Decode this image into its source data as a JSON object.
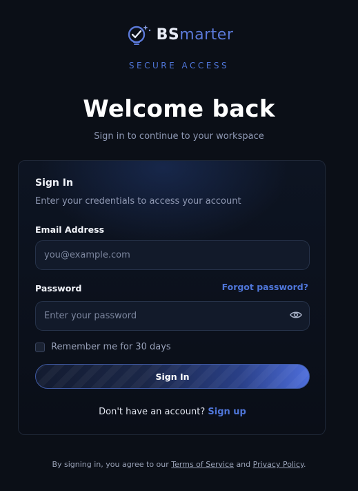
{
  "brand": {
    "name_bold": "BS",
    "name_light": "marter",
    "tagline": "SECURE ACCESS",
    "accent_color": "#4f76d9",
    "logo_icon": "lightbulb-check-icon"
  },
  "header": {
    "title": "Welcome back",
    "subtitle": "Sign in to continue to your workspace"
  },
  "form": {
    "title": "Sign In",
    "description": "Enter your credentials to access your account",
    "email": {
      "label": "Email Address",
      "placeholder": "you@example.com",
      "value": ""
    },
    "password": {
      "label": "Password",
      "placeholder": "Enter your password",
      "value": "",
      "toggle_icon": "eye-icon"
    },
    "forgot_label": "Forgot password?",
    "remember": {
      "label": "Remember me for 30 days",
      "checked": false
    },
    "submit_label": "Sign In",
    "signup_prompt": "Don't have an account?",
    "signup_link": "Sign up"
  },
  "footer": {
    "prefix": "By signing in, you agree to our",
    "terms": "Terms of Service",
    "and": "and",
    "privacy": "Privacy Policy",
    "suffix": "."
  }
}
